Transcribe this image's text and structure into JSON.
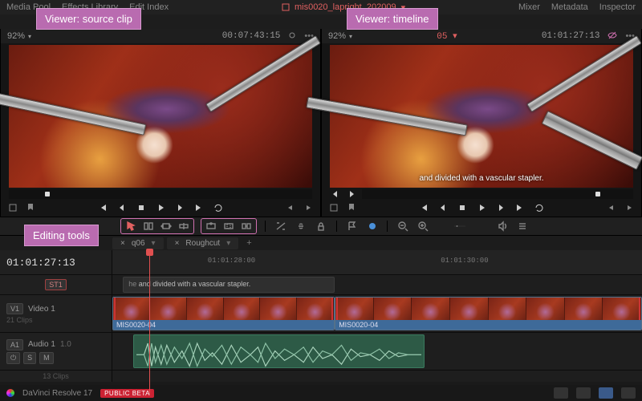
{
  "menubar": {
    "items": [
      "Media Pool",
      "Effects Library",
      "Edit Index"
    ],
    "filename": "mis0020_lapright_202009",
    "right": [
      "Mixer",
      "Metadata",
      "Inspector"
    ]
  },
  "tabs": {
    "a": "q06",
    "b": "Roughcut"
  },
  "viewer_src": {
    "zoom": "92%",
    "tc": "00:07:43:15",
    "title": "mis0020_lapright_202009"
  },
  "viewer_tl": {
    "zoom": "92%",
    "tc": "01:01:27:13",
    "title": "05",
    "caption": "and divided with a vascular stapler."
  },
  "toolbar": {
    "snap": "N"
  },
  "timeline": {
    "main_tc": "01:01:27:13",
    "ruler": [
      "01:01:28:00",
      "01:01:30:00"
    ],
    "sub_track": "ST1",
    "sub_text": "and divided with a vascular stapler.",
    "v1": "V1",
    "v1_name": "Video 1",
    "clip_a": "MIS0020-04",
    "clip_b": "MIS0020-04",
    "a1": "A1",
    "a1_name": "Audio 1",
    "a1_ch": "1.0",
    "a1_sub": "13 Clips",
    "v1_sub": "21 Clips"
  },
  "footer": {
    "app": "DaVinci Resolve 17",
    "beta": "PUBLIC BETA"
  },
  "anno": {
    "src": "Viewer: source clip",
    "tl": "Viewer: timeline",
    "tools": "Editing tools"
  }
}
